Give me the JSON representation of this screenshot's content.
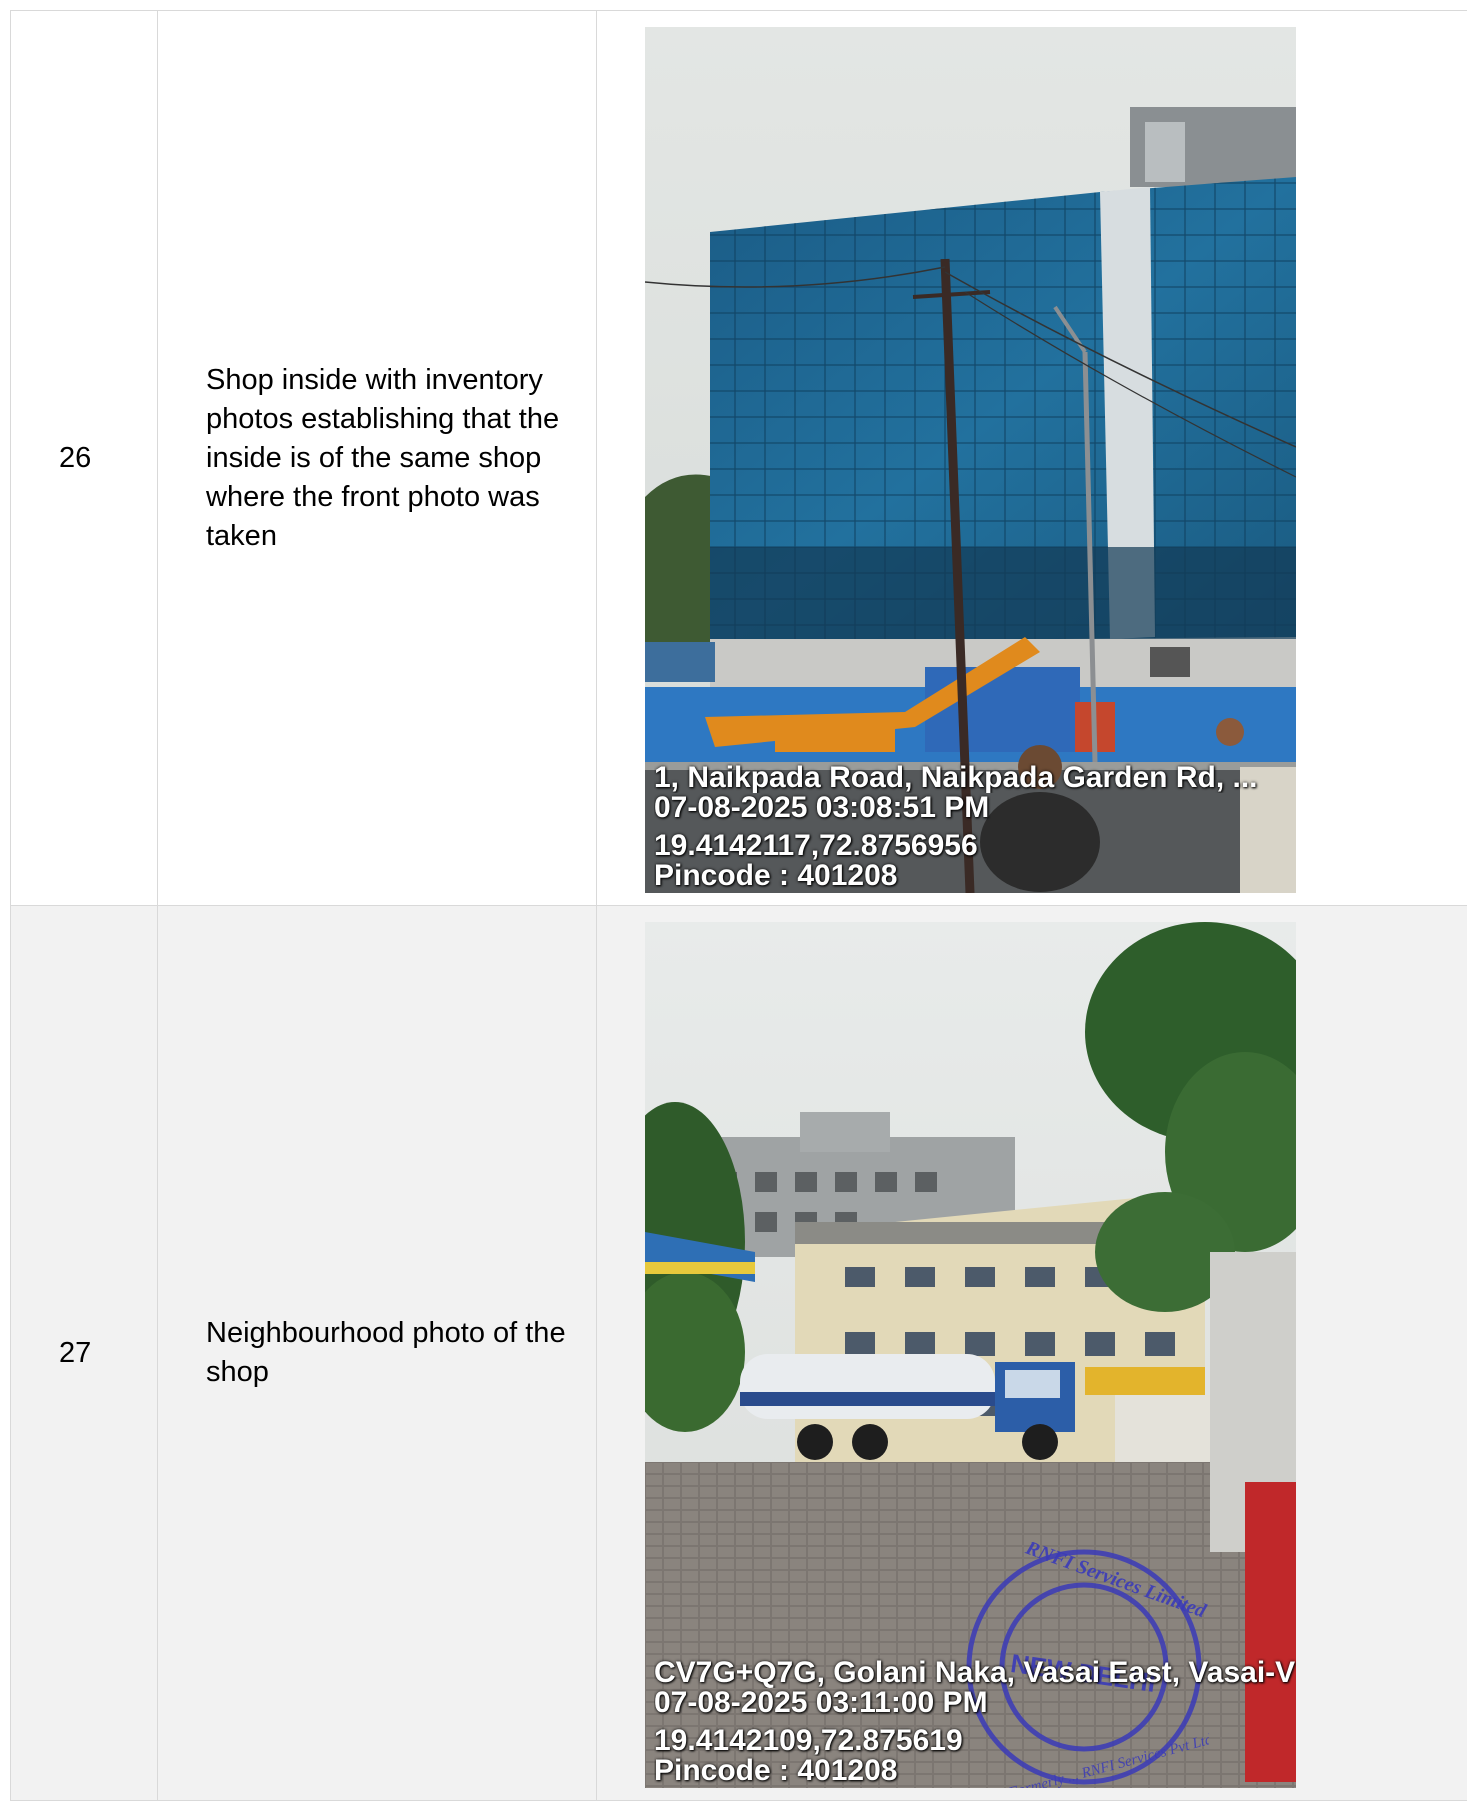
{
  "rows": [
    {
      "number": "26",
      "description": "Shop inside with inventory photos establishing that the inside is of the same shop where the front photo was taken",
      "photo": {
        "subject": "building",
        "address": "1, Naikpada Road, Naikpada Garden Rd, ...",
        "datetime": "07-08-2025 03:08:51 PM",
        "coords": "19.4142117,72.8756956",
        "pincode": "Pincode : 401208"
      }
    },
    {
      "number": "27",
      "description": "Neighbourhood photo of the shop",
      "photo": {
        "subject": "neighbourhood",
        "address": "CV7G+Q7G, Golani Naka, Vasai East, Vasai-V",
        "datetime": "07-08-2025 03:11:00 PM",
        "coords": "19.4142109,72.875619",
        "pincode": "Pincode : 401208",
        "stamp": {
          "company": "RNFI Services Limited",
          "city": "NEW DELHI",
          "formerly": "Formerly ... RNFI Services Pvt Ltd"
        }
      }
    }
  ],
  "colors": {
    "border": "#d9d9d9",
    "alt_row": "#f2f2f2",
    "stamp_ink": "#3b3bb8"
  }
}
